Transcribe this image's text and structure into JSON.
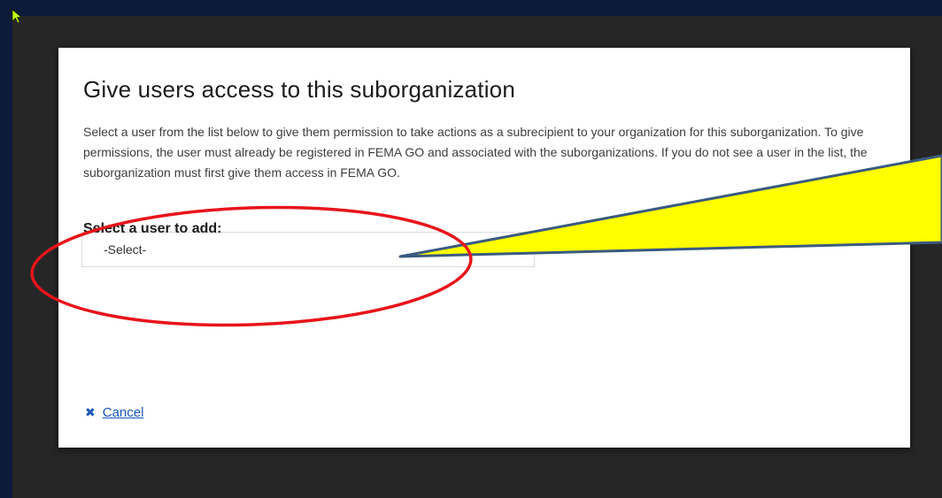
{
  "modal": {
    "title": "Give users access to this suborganization",
    "description": "Select a user from the list below to give them permission to take actions as a subrecipient to your organization for this suborganization. To give permissions, the user must already be registered in FEMA GO and associated with the suborganizations. If you do not see a user in the list, the suborganization must first give them access in FEMA GO.",
    "field_label": "Select a user to add:",
    "select": {
      "value": "-Select-"
    },
    "cancel_label": "Cancel"
  },
  "icons": {
    "cancel": "close-icon",
    "cursor": "mouse-pointer-icon",
    "dropdown": "chevron-down-icon"
  },
  "colors": {
    "annotation_circle": "#e8141b",
    "callout_fill": "#ffff00",
    "callout_stroke": "#3a5a80",
    "link": "#1a56b4"
  }
}
